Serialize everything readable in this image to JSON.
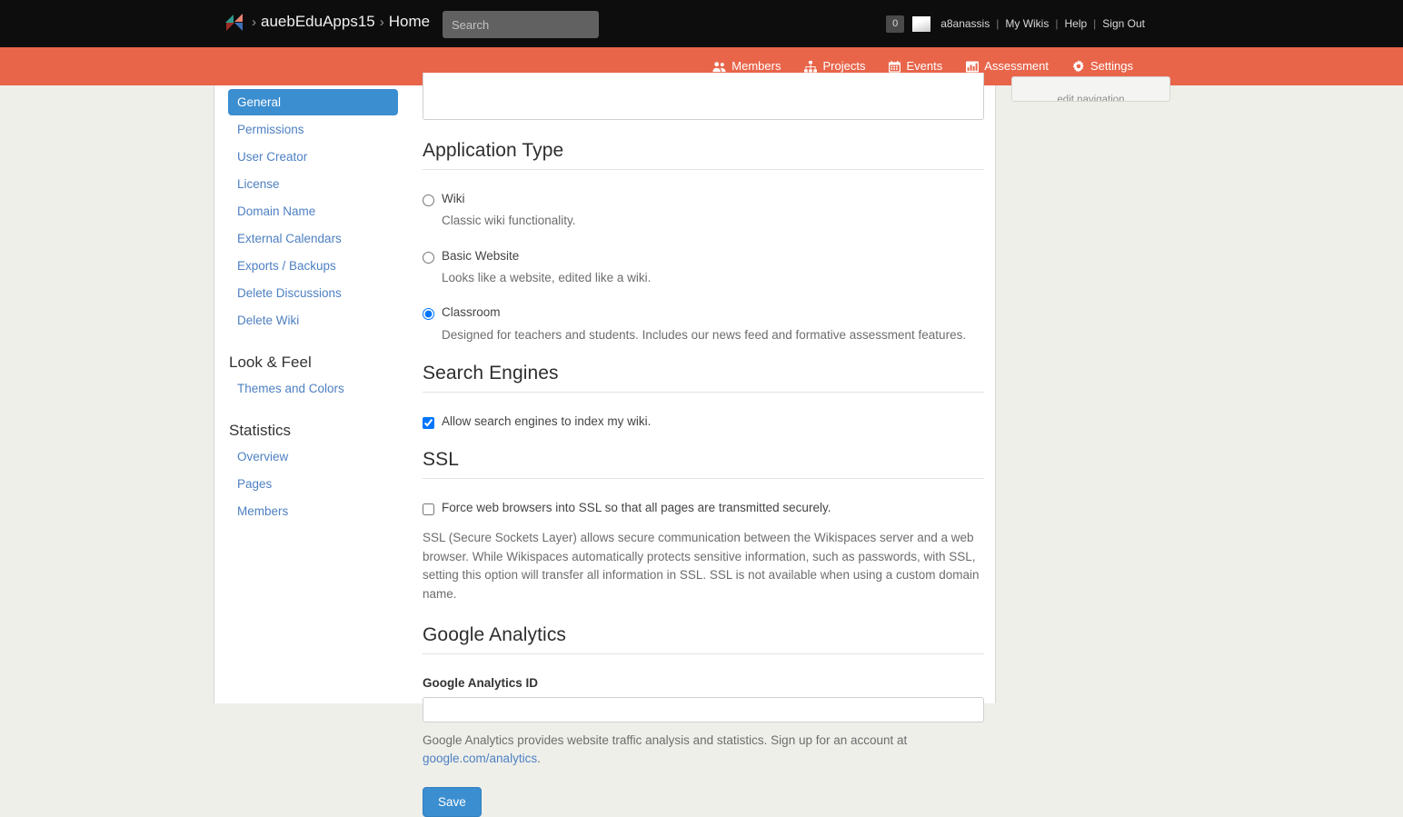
{
  "header": {
    "logo_icon": "wikispaces-pinwheel-logo",
    "wiki_name": "auebEduApps15",
    "page_name": "Home",
    "separator": "›",
    "search_placeholder": "Search",
    "search_value": "",
    "notification_count": "0",
    "username": "a8anassis",
    "links": [
      {
        "label": "My Wikis"
      },
      {
        "label": "Help"
      },
      {
        "label": "Sign Out"
      }
    ],
    "link_separator": "|"
  },
  "navbar": {
    "background": "#e8654a",
    "items": [
      {
        "label": "Members",
        "icon": "users-group-icon"
      },
      {
        "label": "Projects",
        "icon": "sitemap-icon"
      },
      {
        "label": "Events",
        "icon": "calendar-icon"
      },
      {
        "label": "Assessment",
        "icon": "bar-chart-icon"
      },
      {
        "label": "Settings",
        "icon": "gear-icon"
      }
    ]
  },
  "settings_nav": {
    "items": [
      {
        "label": "General",
        "active": true
      },
      {
        "label": "Permissions",
        "active": false
      },
      {
        "label": "User Creator",
        "active": false
      },
      {
        "label": "License",
        "active": false
      },
      {
        "label": "Domain Name",
        "active": false
      },
      {
        "label": "External Calendars",
        "active": false
      },
      {
        "label": "Exports / Backups",
        "active": false
      },
      {
        "label": "Delete Discussions",
        "active": false
      },
      {
        "label": "Delete Wiki",
        "active": false
      }
    ],
    "groups": [
      {
        "title": "Look & Feel",
        "items": [
          {
            "label": "Themes and Colors"
          }
        ]
      },
      {
        "title": "Statistics",
        "items": [
          {
            "label": "Overview"
          },
          {
            "label": "Pages"
          },
          {
            "label": "Members"
          }
        ]
      }
    ]
  },
  "main": {
    "description_textarea_value": "",
    "application_type": {
      "heading": "Application Type",
      "options": [
        {
          "label": "Wiki",
          "description": "Classic wiki functionality.",
          "selected": false
        },
        {
          "label": "Basic Website",
          "description": "Looks like a website, edited like a wiki.",
          "selected": false
        },
        {
          "label": "Classroom",
          "description": "Designed for teachers and students. Includes our news feed and formative assessment features.",
          "selected": true
        }
      ]
    },
    "search_engines": {
      "heading": "Search Engines",
      "checkbox_label": "Allow search engines to index my wiki.",
      "checked": true
    },
    "ssl": {
      "heading": "SSL",
      "checkbox_label": "Force web browsers into SSL so that all pages are transmitted securely.",
      "checked": false,
      "help_text": "SSL (Secure Sockets Layer) allows secure communication between the Wikispaces server and a web browser. While Wikispaces automatically protects sensitive information, such as passwords, with SSL, setting this option will transfer all information in SSL. SSL is not available when using a custom domain name."
    },
    "google_analytics": {
      "heading": "Google Analytics",
      "field_label": "Google Analytics ID",
      "field_value": "",
      "help_text_before": "Google Analytics provides website traffic analysis and statistics. Sign up for an account at ",
      "help_link": "google.com/analytics",
      "help_text_after": "."
    },
    "save_label": "Save"
  },
  "right_sidebar": {
    "edit_navigation_label": "edit navigation"
  },
  "colors": {
    "accent_orange": "#e8654a",
    "accent_blue": "#3b8ed0",
    "link_blue": "#4e80c2",
    "page_bg": "#efefea",
    "topbar_bg": "#0d0d0d"
  }
}
